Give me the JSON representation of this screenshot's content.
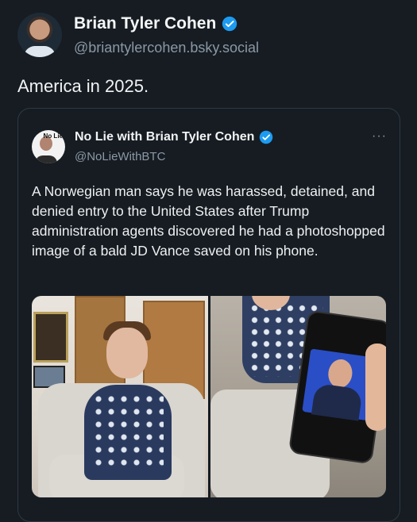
{
  "post": {
    "author_name": "Brian Tyler Cohen",
    "author_handle": "@briantylercohen.bsky.social",
    "text": "America in 2025."
  },
  "quoted_post": {
    "author_name": "No Lie with Brian Tyler Cohen",
    "author_handle": "@NoLieWithBTC",
    "more_label": "···",
    "avatar_logo_text": "No Lie",
    "text": "A Norwegian man says he was harassed, detained, and denied entry to the United States after Trump administration agents discovered he had a photoshopped image of a bald JD Vance saved on his phone."
  },
  "colors": {
    "background": "#161c22",
    "verified_badge": "#1d9bf0",
    "secondary_text": "#8b98a5"
  },
  "icons": {
    "verified": "verified-badge-icon",
    "more": "more-options-icon"
  }
}
